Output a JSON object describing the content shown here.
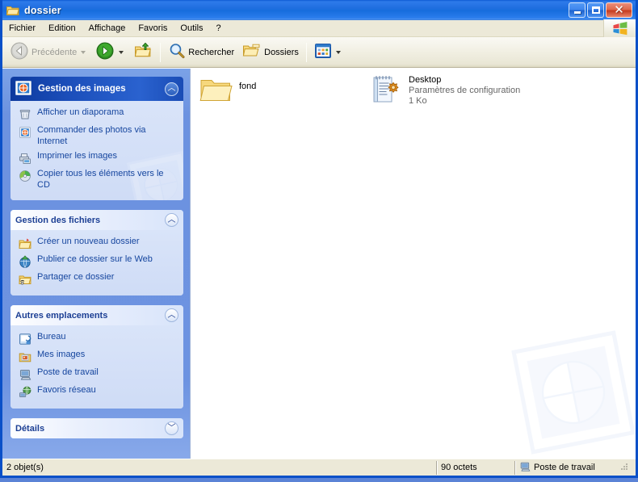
{
  "window": {
    "title": "dossier",
    "title_icon": "open-folder-icon",
    "buttons": {
      "minimize": "Réduire",
      "maximize": "Agrandir",
      "close": "Fermer"
    }
  },
  "menubar": {
    "items": [
      {
        "label": "Fichier"
      },
      {
        "label": "Edition"
      },
      {
        "label": "Affichage"
      },
      {
        "label": "Favoris"
      },
      {
        "label": "Outils"
      },
      {
        "label": "?"
      }
    ],
    "brand_icon": "windows-flag-icon"
  },
  "toolbar": {
    "back": {
      "label": "Précédente",
      "icon": "back-arrow-icon",
      "disabled": true
    },
    "forward": {
      "label": "",
      "icon": "forward-arrow-icon"
    },
    "up": {
      "label": "",
      "icon": "up-folder-icon"
    },
    "search": {
      "label": "Rechercher",
      "icon": "search-icon"
    },
    "folders": {
      "label": "Dossiers",
      "icon": "folders-icon"
    },
    "views": {
      "label": "",
      "icon": "views-icon"
    }
  },
  "sidebar": {
    "panels": [
      {
        "title": "Gestion des images",
        "icon": "picture-tasks-icon",
        "style": "hero",
        "chevron": "chevron-up-icon",
        "collapsed": false,
        "links": [
          {
            "label": "Afficher un diaporama",
            "icon": "slideshow-icon"
          },
          {
            "label": "Commander des photos via Internet",
            "icon": "order-prints-icon"
          },
          {
            "label": "Imprimer les images",
            "icon": "print-pictures-icon"
          },
          {
            "label": "Copier tous les éléments vers le CD",
            "icon": "copy-to-cd-icon"
          }
        ]
      },
      {
        "title": "Gestion des fichiers",
        "icon": "",
        "style": "normal",
        "chevron": "chevron-up-icon",
        "collapsed": false,
        "links": [
          {
            "label": "Créer un nouveau dossier",
            "icon": "new-folder-icon"
          },
          {
            "label": "Publier ce dossier sur le Web",
            "icon": "publish-web-icon"
          },
          {
            "label": "Partager ce dossier",
            "icon": "share-folder-icon"
          }
        ]
      },
      {
        "title": "Autres emplacements",
        "icon": "",
        "style": "normal",
        "chevron": "chevron-up-icon",
        "collapsed": false,
        "links": [
          {
            "label": "Bureau",
            "icon": "desktop-icon"
          },
          {
            "label": "Mes images",
            "icon": "my-pictures-icon"
          },
          {
            "label": "Poste de travail",
            "icon": "my-computer-icon"
          },
          {
            "label": "Favoris réseau",
            "icon": "network-places-icon"
          }
        ]
      },
      {
        "title": "Détails",
        "icon": "",
        "style": "normal",
        "chevron": "chevron-down-icon",
        "collapsed": true,
        "links": []
      }
    ]
  },
  "content": {
    "items": [
      {
        "name": "fond",
        "type": "",
        "size": "",
        "icon": "folder-icon"
      },
      {
        "name": "Desktop",
        "type": "Paramètres de configuration",
        "size": "1 Ko",
        "icon": "config-settings-icon"
      }
    ],
    "watermark_icon": "my-pictures-watermark"
  },
  "statusbar": {
    "object_count": "2 objet(s)",
    "size": "90 octets",
    "location": "Poste de travail",
    "location_icon": "my-computer-icon"
  },
  "colors": {
    "title_blue": "#1f6ee0",
    "sidebar_blue": "#6d93e1",
    "panel_body": "#d3dff7",
    "link_blue": "#15459e",
    "chrome": "#ece9d8"
  }
}
